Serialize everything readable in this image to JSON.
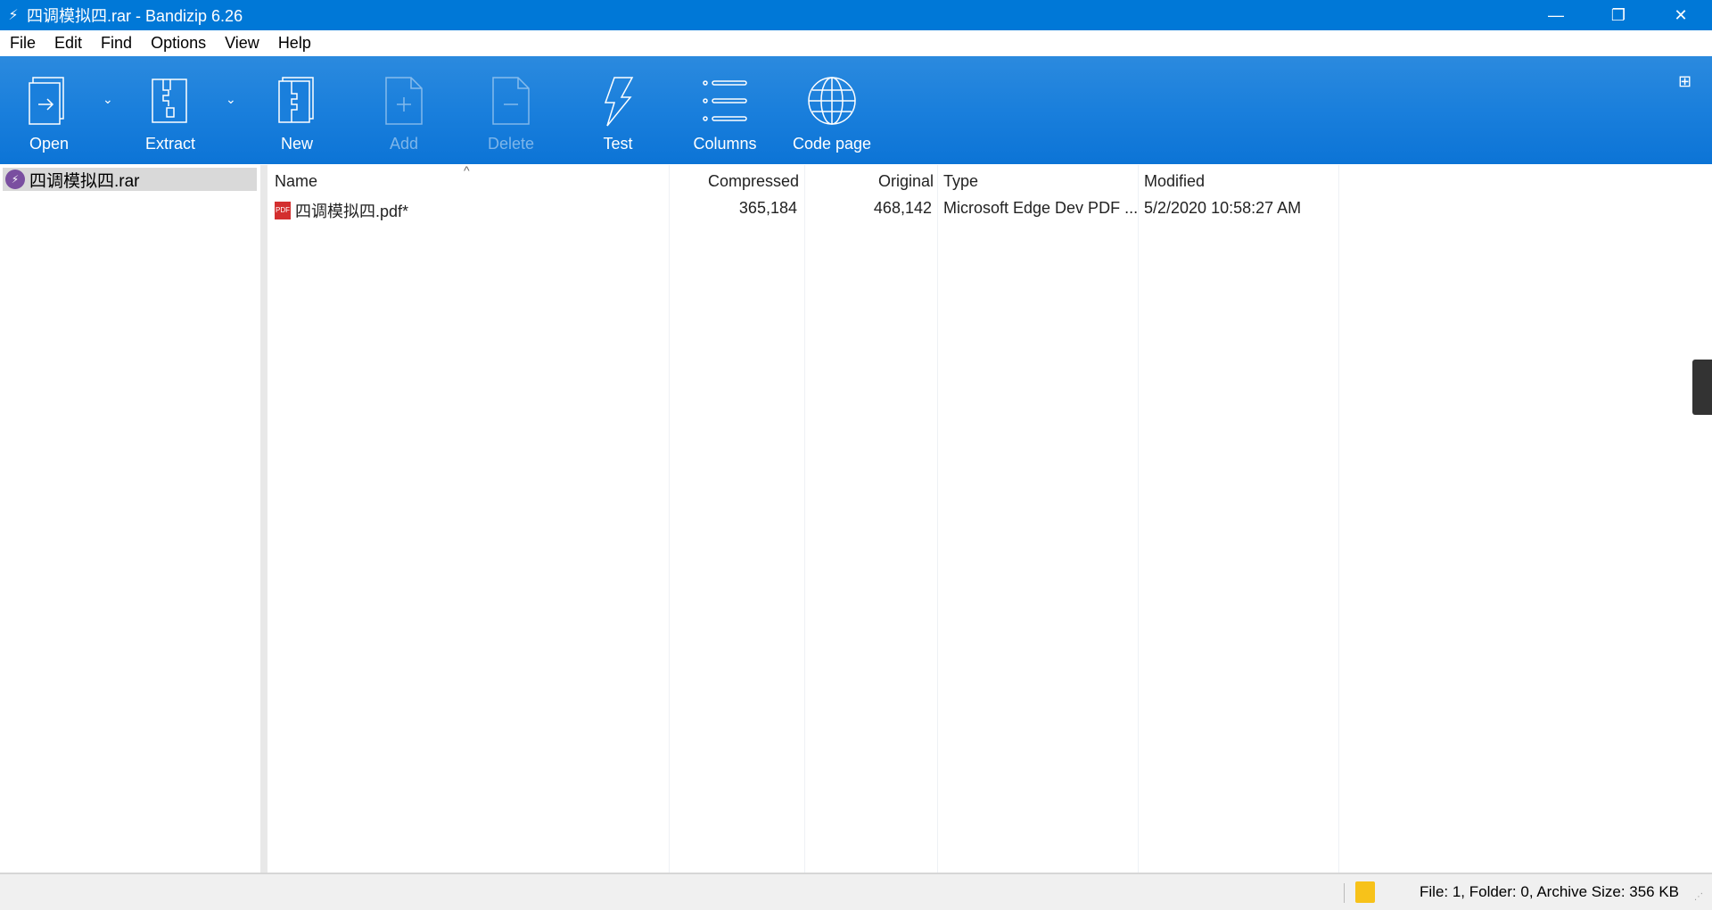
{
  "window": {
    "title": "四调模拟四.rar - Bandizip 6.26",
    "minimize": "—",
    "restore": "❐",
    "close": "✕"
  },
  "menu": [
    "File",
    "Edit",
    "Find",
    "Options",
    "View",
    "Help"
  ],
  "toolbar": {
    "open": "Open",
    "extract": "Extract",
    "new": "New",
    "add": "Add",
    "delete": "Delete",
    "test": "Test",
    "columns": "Columns",
    "codepage": "Code page"
  },
  "tree": {
    "archive": "四调模拟四.rar"
  },
  "columns": {
    "name": "Name",
    "compressed": "Compressed",
    "original": "Original",
    "type": "Type",
    "modified": "Modified"
  },
  "files": [
    {
      "name": "四调模拟四.pdf*",
      "compressed": "365,184",
      "original": "468,142",
      "type": "Microsoft Edge Dev PDF ...",
      "modified": "5/2/2020 10:58:27 AM"
    }
  ],
  "status": {
    "text": "File: 1, Folder: 0, Archive Size: 356 KB"
  },
  "colors": {
    "titlebar": "#0078d7",
    "toolbar": "#1a7fdc"
  }
}
